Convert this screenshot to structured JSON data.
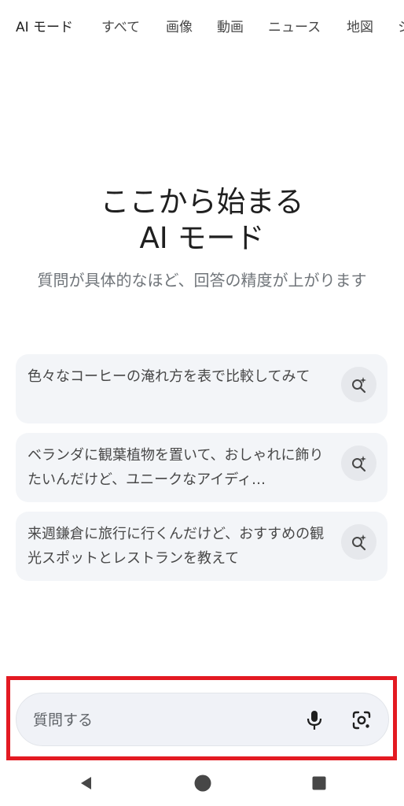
{
  "tabs": [
    {
      "label": "AI モード"
    },
    {
      "label": "すべて"
    },
    {
      "label": "画像"
    },
    {
      "label": "動画"
    },
    {
      "label": "ニュース"
    },
    {
      "label": "地図"
    },
    {
      "label": "シ"
    }
  ],
  "hero": {
    "title_line1": "ここから始まる",
    "title_line2": "AI モード",
    "subtitle": "質問が具体的なほど、回答の精度が上がります"
  },
  "suggestions": [
    {
      "text": "色々なコーヒーの淹れ方を表で比較してみて"
    },
    {
      "text": "ベランダに観葉植物を置いて、おしゃれに飾りたいんだけど、ユニークなアイディ…"
    },
    {
      "text": "来週鎌倉に旅行に行くんだけど、おすすめの観光スポットとレストランを教えて"
    }
  ],
  "search": {
    "placeholder": "質問する"
  },
  "icons": {
    "suggestion": "search-sparkle-icon",
    "mic": "mic-icon",
    "lens": "camera-lens-icon",
    "back": "back-triangle-icon",
    "home": "home-circle-icon",
    "recents": "recents-square-icon"
  },
  "colors": {
    "highlight": "#e31a22",
    "card_bg": "#f3f5f8",
    "search_bg": "#f0f2f7"
  }
}
